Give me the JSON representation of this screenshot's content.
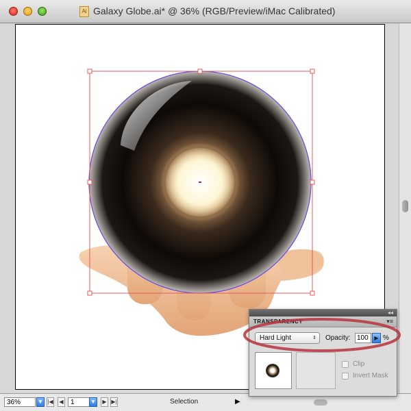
{
  "window": {
    "title": "Galaxy Globe.ai* @ 36% (RGB/Preview/iMac Calibrated)",
    "doc_icon": "illustrator-document-icon"
  },
  "status_bar": {
    "zoom": "36%",
    "page": "1",
    "current_tool": "Selection",
    "arrow": "▶"
  },
  "transparency_panel": {
    "title": "TRANSPARENCY",
    "blend_mode": "Hard Light",
    "opacity_label": "Opacity:",
    "opacity_value": "100",
    "opacity_unit": "%",
    "clip_label": "Clip",
    "invert_mask_label": "Invert Mask",
    "clip_checked": false,
    "invert_mask_checked": false
  },
  "colors": {
    "selection": "#e8585a",
    "highlight_circle": "#b6343c",
    "slider_blue": "#2f7ee2"
  }
}
